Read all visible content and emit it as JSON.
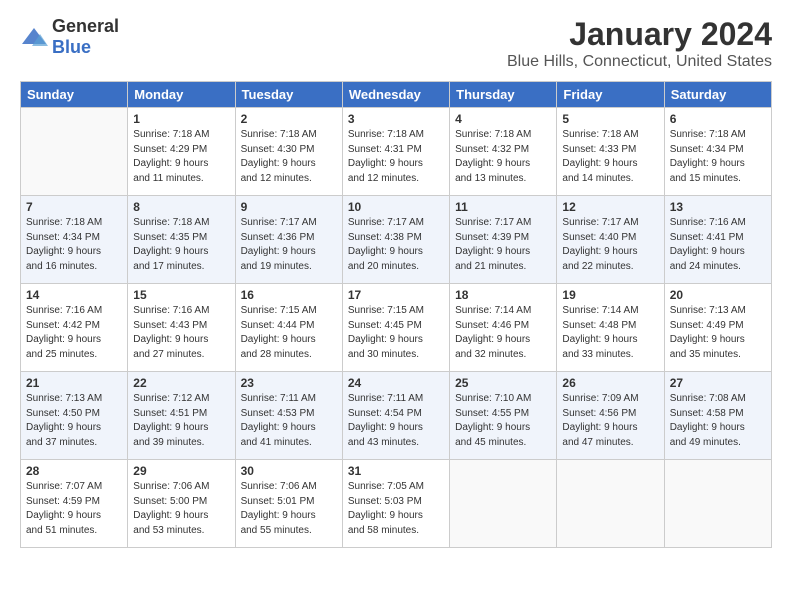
{
  "header": {
    "logo": {
      "general": "General",
      "blue": "Blue"
    },
    "title": "January 2024",
    "location": "Blue Hills, Connecticut, United States"
  },
  "weekdays": [
    "Sunday",
    "Monday",
    "Tuesday",
    "Wednesday",
    "Thursday",
    "Friday",
    "Saturday"
  ],
  "weeks": [
    [
      {
        "day": "",
        "info": ""
      },
      {
        "day": "1",
        "info": "Sunrise: 7:18 AM\nSunset: 4:29 PM\nDaylight: 9 hours\nand 11 minutes."
      },
      {
        "day": "2",
        "info": "Sunrise: 7:18 AM\nSunset: 4:30 PM\nDaylight: 9 hours\nand 12 minutes."
      },
      {
        "day": "3",
        "info": "Sunrise: 7:18 AM\nSunset: 4:31 PM\nDaylight: 9 hours\nand 12 minutes."
      },
      {
        "day": "4",
        "info": "Sunrise: 7:18 AM\nSunset: 4:32 PM\nDaylight: 9 hours\nand 13 minutes."
      },
      {
        "day": "5",
        "info": "Sunrise: 7:18 AM\nSunset: 4:33 PM\nDaylight: 9 hours\nand 14 minutes."
      },
      {
        "day": "6",
        "info": "Sunrise: 7:18 AM\nSunset: 4:34 PM\nDaylight: 9 hours\nand 15 minutes."
      }
    ],
    [
      {
        "day": "7",
        "info": "Sunrise: 7:18 AM\nSunset: 4:34 PM\nDaylight: 9 hours\nand 16 minutes."
      },
      {
        "day": "8",
        "info": "Sunrise: 7:18 AM\nSunset: 4:35 PM\nDaylight: 9 hours\nand 17 minutes."
      },
      {
        "day": "9",
        "info": "Sunrise: 7:17 AM\nSunset: 4:36 PM\nDaylight: 9 hours\nand 19 minutes."
      },
      {
        "day": "10",
        "info": "Sunrise: 7:17 AM\nSunset: 4:38 PM\nDaylight: 9 hours\nand 20 minutes."
      },
      {
        "day": "11",
        "info": "Sunrise: 7:17 AM\nSunset: 4:39 PM\nDaylight: 9 hours\nand 21 minutes."
      },
      {
        "day": "12",
        "info": "Sunrise: 7:17 AM\nSunset: 4:40 PM\nDaylight: 9 hours\nand 22 minutes."
      },
      {
        "day": "13",
        "info": "Sunrise: 7:16 AM\nSunset: 4:41 PM\nDaylight: 9 hours\nand 24 minutes."
      }
    ],
    [
      {
        "day": "14",
        "info": "Sunrise: 7:16 AM\nSunset: 4:42 PM\nDaylight: 9 hours\nand 25 minutes."
      },
      {
        "day": "15",
        "info": "Sunrise: 7:16 AM\nSunset: 4:43 PM\nDaylight: 9 hours\nand 27 minutes."
      },
      {
        "day": "16",
        "info": "Sunrise: 7:15 AM\nSunset: 4:44 PM\nDaylight: 9 hours\nand 28 minutes."
      },
      {
        "day": "17",
        "info": "Sunrise: 7:15 AM\nSunset: 4:45 PM\nDaylight: 9 hours\nand 30 minutes."
      },
      {
        "day": "18",
        "info": "Sunrise: 7:14 AM\nSunset: 4:46 PM\nDaylight: 9 hours\nand 32 minutes."
      },
      {
        "day": "19",
        "info": "Sunrise: 7:14 AM\nSunset: 4:48 PM\nDaylight: 9 hours\nand 33 minutes."
      },
      {
        "day": "20",
        "info": "Sunrise: 7:13 AM\nSunset: 4:49 PM\nDaylight: 9 hours\nand 35 minutes."
      }
    ],
    [
      {
        "day": "21",
        "info": "Sunrise: 7:13 AM\nSunset: 4:50 PM\nDaylight: 9 hours\nand 37 minutes."
      },
      {
        "day": "22",
        "info": "Sunrise: 7:12 AM\nSunset: 4:51 PM\nDaylight: 9 hours\nand 39 minutes."
      },
      {
        "day": "23",
        "info": "Sunrise: 7:11 AM\nSunset: 4:53 PM\nDaylight: 9 hours\nand 41 minutes."
      },
      {
        "day": "24",
        "info": "Sunrise: 7:11 AM\nSunset: 4:54 PM\nDaylight: 9 hours\nand 43 minutes."
      },
      {
        "day": "25",
        "info": "Sunrise: 7:10 AM\nSunset: 4:55 PM\nDaylight: 9 hours\nand 45 minutes."
      },
      {
        "day": "26",
        "info": "Sunrise: 7:09 AM\nSunset: 4:56 PM\nDaylight: 9 hours\nand 47 minutes."
      },
      {
        "day": "27",
        "info": "Sunrise: 7:08 AM\nSunset: 4:58 PM\nDaylight: 9 hours\nand 49 minutes."
      }
    ],
    [
      {
        "day": "28",
        "info": "Sunrise: 7:07 AM\nSunset: 4:59 PM\nDaylight: 9 hours\nand 51 minutes."
      },
      {
        "day": "29",
        "info": "Sunrise: 7:06 AM\nSunset: 5:00 PM\nDaylight: 9 hours\nand 53 minutes."
      },
      {
        "day": "30",
        "info": "Sunrise: 7:06 AM\nSunset: 5:01 PM\nDaylight: 9 hours\nand 55 minutes."
      },
      {
        "day": "31",
        "info": "Sunrise: 7:05 AM\nSunset: 5:03 PM\nDaylight: 9 hours\nand 58 minutes."
      },
      {
        "day": "",
        "info": ""
      },
      {
        "day": "",
        "info": ""
      },
      {
        "day": "",
        "info": ""
      }
    ]
  ]
}
